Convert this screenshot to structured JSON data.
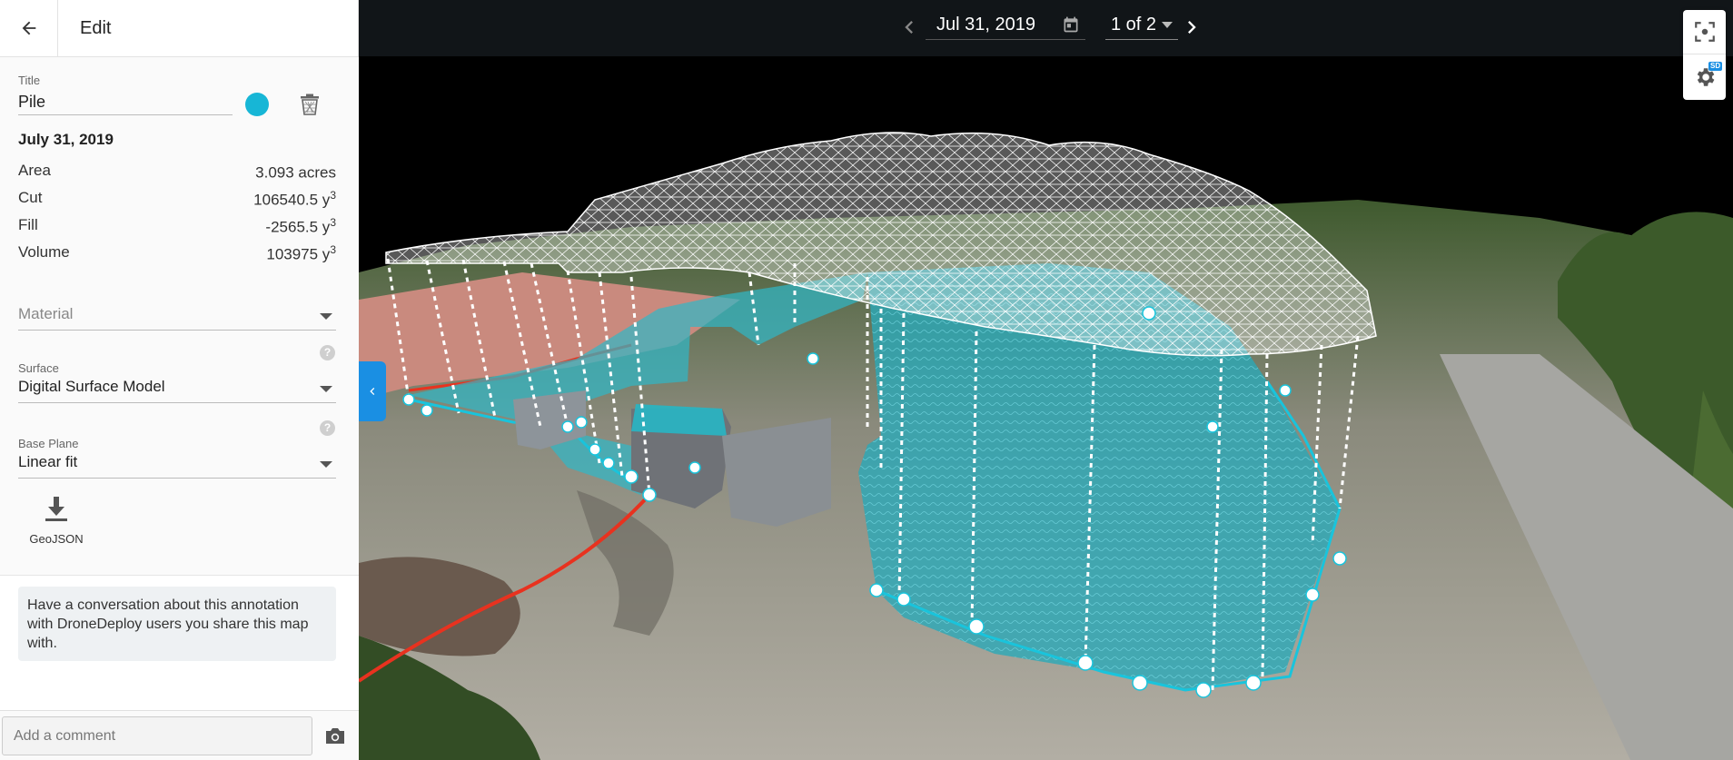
{
  "sidebar": {
    "header": {
      "title": "Edit",
      "back_icon": "arrow-left-icon"
    },
    "title_field": {
      "label": "Title",
      "value": "Pile"
    },
    "color": "#17b6d6",
    "date": "July 31, 2019",
    "stats": [
      {
        "label": "Area",
        "value": "3.093 acres",
        "unit_sup": ""
      },
      {
        "label": "Cut",
        "value": "106540.5 y",
        "unit_sup": "3"
      },
      {
        "label": "Fill",
        "value": "-2565.5 y",
        "unit_sup": "3"
      },
      {
        "label": "Volume",
        "value": "103975 y",
        "unit_sup": "3"
      }
    ],
    "material": {
      "placeholder": "Material"
    },
    "surface": {
      "label": "Surface",
      "value": "Digital Surface Model"
    },
    "base_plane": {
      "label": "Base Plane",
      "value": "Linear fit"
    },
    "help_glyph": "?",
    "export": {
      "label": "GeoJSON"
    },
    "chat_note": "Have a conversation about this annotation with DroneDeploy users you share this map with.",
    "comment": {
      "placeholder": "Add a comment"
    }
  },
  "map": {
    "date": "Jul 31, 2019",
    "page": "1 of 2",
    "badge": "SD",
    "accent": "#1a8fe3"
  }
}
